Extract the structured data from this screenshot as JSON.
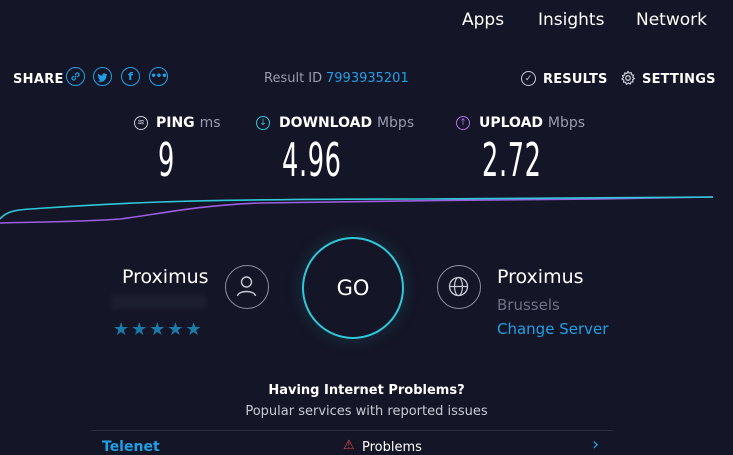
{
  "nav": {
    "items": [
      "Apps",
      "Insights",
      "Network"
    ]
  },
  "share": {
    "label": "SHARE",
    "icons": [
      "link-icon",
      "twitter-icon",
      "facebook-icon",
      "more-icon"
    ]
  },
  "result": {
    "label": "Result ID",
    "id": "7993935201"
  },
  "header_links": {
    "results": "RESULTS",
    "settings": "SETTINGS"
  },
  "metrics": {
    "ping": {
      "label": "PING",
      "unit": "ms",
      "value": "9"
    },
    "download": {
      "label": "DOWNLOAD",
      "unit": "Mbps",
      "value": "4.96"
    },
    "upload": {
      "label": "UPLOAD",
      "unit": "Mbps",
      "value": "2.72"
    }
  },
  "isp": {
    "name": "Proximus",
    "rating_stars": 5,
    "stars_text": "★★★★★"
  },
  "go": {
    "label": "GO"
  },
  "server": {
    "name": "Proximus",
    "city": "Brussels",
    "change_label": "Change Server"
  },
  "problems": {
    "title": "Having Internet Problems?",
    "subtitle": "Popular services with reported issues",
    "rows": [
      {
        "service": "Telenet",
        "status": "Problems"
      }
    ]
  },
  "colors": {
    "background": "#141526",
    "accent": "#1ea0e6",
    "download": "#2ec8d8",
    "upload": "#b070e8",
    "warning": "#e8474a"
  }
}
